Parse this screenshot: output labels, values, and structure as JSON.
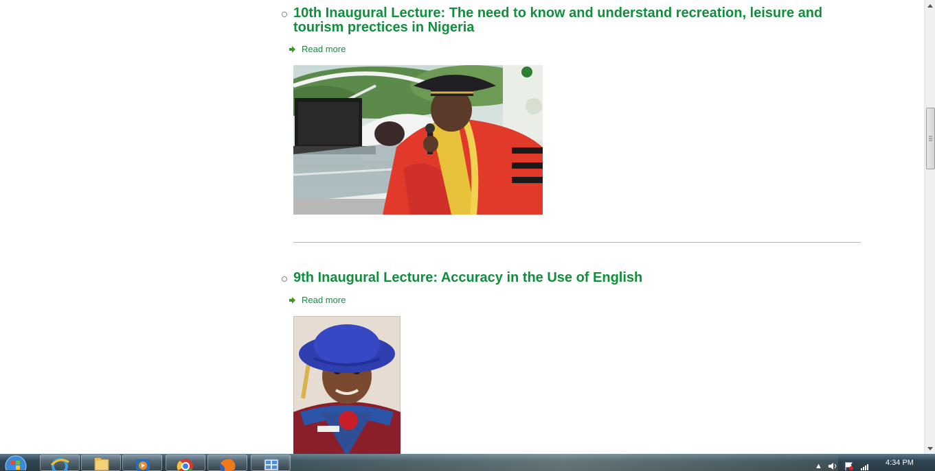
{
  "articles": [
    {
      "title": "10th Inaugural Lecture: The need to know and understand recreation, leisure and tourism prectices in Nigeria",
      "read_more": "Read more",
      "image_icon": "lecturer-photo"
    },
    {
      "title": "9th Inaugural Lecture: Accuracy in the Use of English",
      "read_more": "Read more",
      "image_icon": "lecturer-photo"
    }
  ],
  "colors": {
    "link_green": "#0f8f3c",
    "divider": "#b5b5b5"
  },
  "taskbar": {
    "clock": "4:34 PM",
    "apps": [
      "windows-start-icon",
      "internet-explorer-icon",
      "file-explorer-icon",
      "media-player-icon",
      "chrome-icon",
      "firefox-icon",
      "control-panel-icon"
    ]
  }
}
